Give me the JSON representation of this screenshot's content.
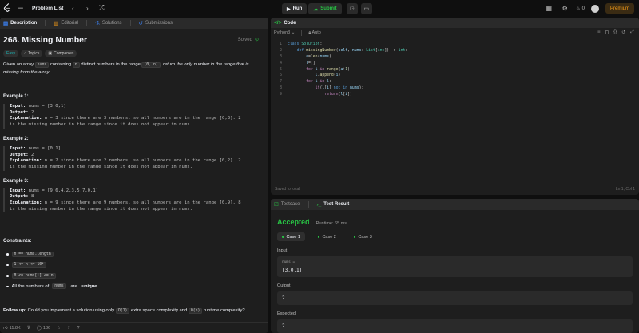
{
  "topbar": {
    "problem_list": "Problem List",
    "run": "Run",
    "submit": "Submit",
    "streak": "0",
    "premium": "Premium"
  },
  "tabs": [
    "Description",
    "Editorial",
    "Solutions",
    "Submissions"
  ],
  "problem": {
    "title": "268. Missing Number",
    "status": "Solved",
    "chips": [
      "Easy",
      "Topics",
      "Companies"
    ],
    "intro": {
      "p1": "Given an array ",
      "c1": "nums",
      "p2": " containing ",
      "c2": "n",
      "p3": " distinct numbers in the range ",
      "c3": "[0, n]",
      "p4": ", return the only number in the range that is missing from the array."
    },
    "examples": [
      {
        "title": "Example 1:",
        "input_label": "Input:",
        "input": " nums = [3,0,1]",
        "output_label": "Output:",
        "output": " 2",
        "expl_label": "Explanation:",
        "expl1": " n = 3 since there are 3 numbers, so all numbers are in the range [0,3]. 2",
        "expl2": "is the missing number in the range since it does not appear in nums."
      },
      {
        "title": "Example 2:",
        "input_label": "Input:",
        "input": " nums = [0,1]",
        "output_label": "Output:",
        "output": " 2",
        "expl_label": "Explanation:",
        "expl1": " n = 2 since there are 2 numbers, so all numbers are in the range [0,2]. 2",
        "expl2": "is the missing number in the range since it does not appear in nums."
      },
      {
        "title": "Example 3:",
        "input_label": "Input:",
        "input": " nums = [9,6,4,2,3,5,7,0,1]",
        "output_label": "Output:",
        "output": " 8",
        "expl_label": "Explanation:",
        "expl1": " n = 9 since there are 9 numbers, so all numbers are in the range [0,9]. 8",
        "expl2": "is the missing number in the range since it does not appear in nums."
      }
    ],
    "constraints_title": "Constraints:",
    "constraints": [
      "n == nums.length",
      "1 <= n <= 10⁴",
      "0 <= nums[i] <= n"
    ],
    "constraint_last": {
      "p1": "All the numbers of ",
      "c1": "nums",
      "p2": " are ",
      "b": "unique."
    },
    "follow_up": {
      "label": "Follow up:",
      "p1": " Could you implement a solution using only ",
      "c1": "O(1)",
      "p2": " extra space complexity and ",
      "c2": "O(n)",
      "p3": " runtime complexity?"
    }
  },
  "footer": {
    "likes": "11.8K",
    "comments": "186"
  },
  "code_panel": {
    "title": "Code",
    "language": "Python3",
    "mode": "Auto",
    "saved": "Saved to local",
    "cursor": "Ln 1, Col 1"
  },
  "result_panel": {
    "tab_testcase": "Testcase",
    "tab_result": "Test Result",
    "status": "Accepted",
    "runtime": "Runtime: 65 ms",
    "cases": [
      "Case 1",
      "Case 2",
      "Case 3"
    ],
    "input_label": "Input",
    "param_name": "nums =",
    "param_value": "[3,0,1]",
    "output_label": "Output",
    "output_value": "2",
    "expected_label": "Expected",
    "expected_value": "2"
  },
  "colors": {
    "accent": "#ffa116",
    "success": "#28c244",
    "easy": "#1cbaba",
    "panel": "#1e1e1e",
    "bg": "#0f0f0f"
  }
}
